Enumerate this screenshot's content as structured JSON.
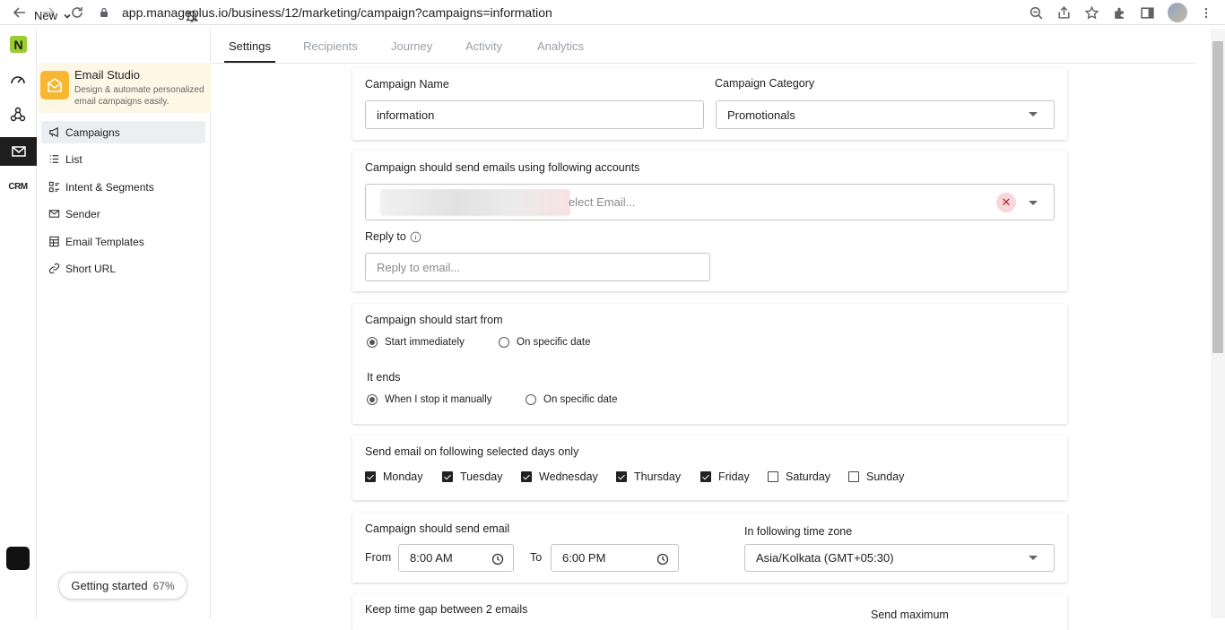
{
  "browser": {
    "url": "app.manageplus.io/business/12/marketing/campaign?campaigns=information"
  },
  "topbar": {
    "logo_letter": "N",
    "new_label": "New"
  },
  "rail": {
    "crm_label": "CRM"
  },
  "studio": {
    "title": "Email Studio",
    "description": "Design & automate personalized email campaigns easily."
  },
  "sidebar": {
    "items": [
      {
        "label": "Campaigns",
        "icon": "megaphone-icon"
      },
      {
        "label": "List",
        "icon": "list-icon"
      },
      {
        "label": "Intent & Segments",
        "icon": "segments-icon"
      },
      {
        "label": "Sender",
        "icon": "mail-icon"
      },
      {
        "label": "Email Templates",
        "icon": "template-icon"
      },
      {
        "label": "Short URL",
        "icon": "link-icon"
      }
    ],
    "getting_started": {
      "label": "Getting started",
      "percent": "67%"
    }
  },
  "tabs": [
    "Settings",
    "Recipients",
    "Journey",
    "Activity",
    "Analytics"
  ],
  "form": {
    "campaign_name_label": "Campaign Name",
    "campaign_name_value": "information",
    "campaign_category_label": "Campaign Category",
    "campaign_category_value": "Promotionals",
    "accounts_label": "Campaign should send emails using following accounts",
    "accounts_placeholder": "Select Email...",
    "accounts_placeholder_visible": "elect Email...",
    "reply_to_label": "Reply to",
    "reply_to_placeholder": "Reply to email...",
    "start_label": "Campaign should start from",
    "start_options": [
      "Start immediately",
      "On specific date"
    ],
    "ends_label": "It ends",
    "ends_options": [
      "When I stop it manually",
      "On specific date"
    ],
    "days_label": "Send email on following selected days only",
    "days": [
      {
        "label": "Monday",
        "checked": true
      },
      {
        "label": "Tuesday",
        "checked": true
      },
      {
        "label": "Wednesday",
        "checked": true
      },
      {
        "label": "Thursday",
        "checked": true
      },
      {
        "label": "Friday",
        "checked": true
      },
      {
        "label": "Saturday",
        "checked": false
      },
      {
        "label": "Sunday",
        "checked": false
      }
    ],
    "send_label": "Campaign should send email",
    "from_label": "From",
    "from_value": "8:00 AM",
    "to_label": "To",
    "to_value": "6:00 PM",
    "timezone_label": "In following time zone",
    "timezone_value": "Asia/Kolkata (GMT+05:30)",
    "gap_label": "Keep time gap between 2 emails",
    "send_max_label": "Send maximum"
  }
}
